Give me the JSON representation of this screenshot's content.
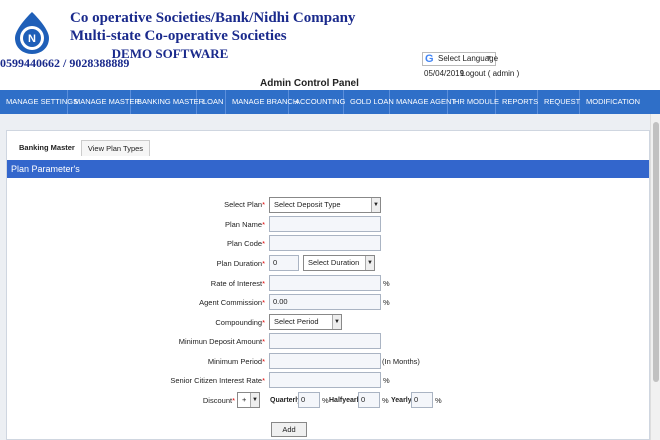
{
  "header": {
    "company_line1": "Co operative Societies/Bank/Nidhi Company",
    "company_line2": "Multi-state Co-operative Societies",
    "company_line3": "DEMO SOFTWARE",
    "phone": "0599440662  / 9028388889",
    "translate_label": "Select Language",
    "translate_arrow": "▼",
    "date": "05/04/2019",
    "logout": "Logout ( admin )",
    "panel_title": "Admin Control Panel",
    "logo_letter": "N"
  },
  "nav": [
    "MANAGE SETTINGS",
    "MANAGE MASTER",
    "BANKING MASTER",
    "LOAN",
    "MANAGE BRANCH",
    "ACCOUNTING",
    "GOLD LOAN",
    "MANAGE AGENT",
    "HR MODULE",
    "REPORTS",
    "REQUEST",
    "MODIFICATION"
  ],
  "tabs": {
    "active": "Banking Master",
    "inactive": "View Plan Types"
  },
  "section_title": "Plan Parameter's",
  "form": {
    "select_plan": {
      "label": "Select Plan",
      "value": "Select Deposit Type"
    },
    "plan_name": {
      "label": "Plan Name",
      "value": ""
    },
    "plan_code": {
      "label": "Plan Code",
      "value": ""
    },
    "plan_duration": {
      "label": "Plan Duration",
      "value": "0",
      "unit": "Select Duration"
    },
    "rate_of_interest": {
      "label": "Rate of Interest",
      "value": "",
      "suffix": "%"
    },
    "agent_commission": {
      "label": "Agent Commission",
      "value": "0.00",
      "suffix": "%"
    },
    "compounding": {
      "label": "Compounding",
      "value": "Select Period"
    },
    "min_deposit": {
      "label": "Minimun Deposit Amount",
      "value": ""
    },
    "min_period": {
      "label": "Minimum Period",
      "value": "",
      "suffix": "(In Months)"
    },
    "senior_rate": {
      "label": "Senior Citizen Interest Rate",
      "value": "",
      "suffix": "%"
    },
    "discount": {
      "label": "Discount",
      "sign": "+",
      "quarterly_label": "Quarterly",
      "quarterly_value": "0",
      "halfyearly_label": "Halfyearly",
      "halfyearly_value": "0",
      "yearly_label": "Yearly",
      "yearly_value": "0",
      "suffix": "%"
    },
    "required_mark": "*",
    "add_label": "Add"
  },
  "colors": {
    "nav_bg": "#2f6fc8",
    "section_bg": "#3366cc",
    "company_text": "#1a2a8c",
    "required": "#dd0000"
  }
}
